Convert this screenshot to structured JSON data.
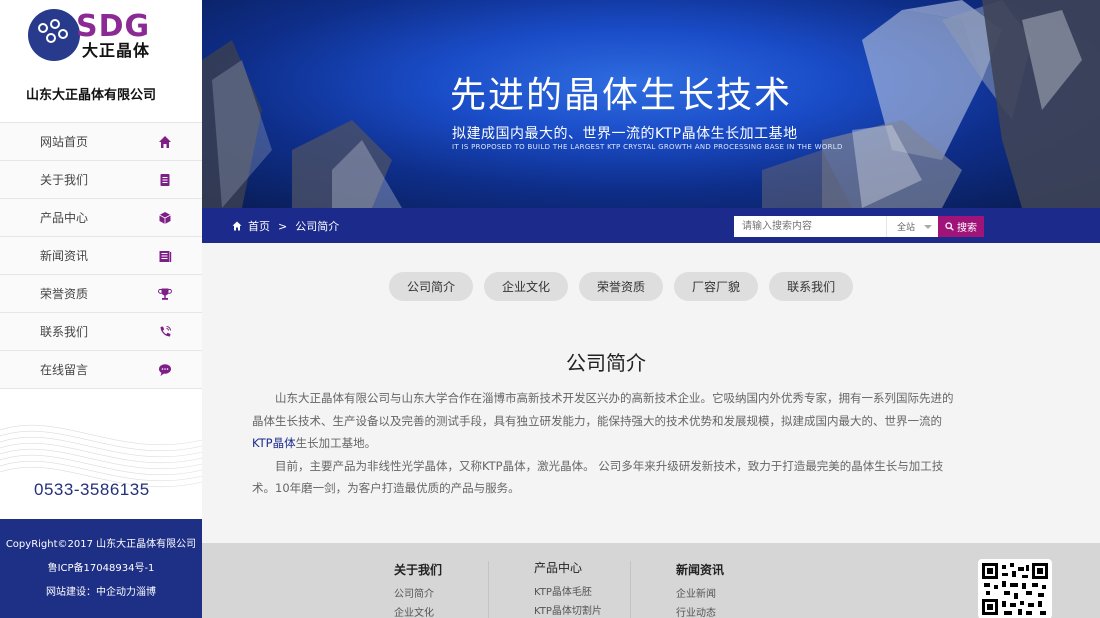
{
  "sidebar": {
    "logo_text": "SDG",
    "logo_cn": "大正晶体",
    "company_name": "山东大正晶体有限公司",
    "nav": [
      {
        "label": "网站首页",
        "icon": "home-icon"
      },
      {
        "label": "关于我们",
        "icon": "document-icon"
      },
      {
        "label": "产品中心",
        "icon": "cube-icon"
      },
      {
        "label": "新闻资讯",
        "icon": "news-icon"
      },
      {
        "label": "荣誉资质",
        "icon": "trophy-icon"
      },
      {
        "label": "联系我们",
        "icon": "phone-icon"
      },
      {
        "label": "在线留言",
        "icon": "chat-icon"
      }
    ],
    "phone": "0533-3586135",
    "footer": {
      "copyright": "CopyRight©2017 山东大正晶体有限公司",
      "icp": "鲁ICP备17048934号-1",
      "built_by": "网站建设：中企动力淄博"
    }
  },
  "banner": {
    "title": "先进的晶体生长技术",
    "subtitle": "拟建成国内最大的、世界一流的KTP晶体生长加工基地",
    "subtitle_en": "IT IS PROPOSED TO BUILD THE LARGEST KTP CRYSTAL GROWTH AND PROCESSING BASE IN THE WORLD"
  },
  "breadcrumb": {
    "home": "首页",
    "separator": ">",
    "current": "公司简介"
  },
  "search": {
    "placeholder": "请输入搜索内容",
    "scope": "全站",
    "button": "搜索"
  },
  "tabs": [
    "公司简介",
    "企业文化",
    "荣誉资质",
    "厂容厂貌",
    "联系我们"
  ],
  "content": {
    "title": "公司简介",
    "p1_a": "山东大正晶体有限公司与山东大学合作在淄博市高新技术开发区兴办的高新技术企业。它吸纳国内外优秀专家，拥有一系列国际先进的晶体生长技术、生产设备以及完善的测试手段，具有独立研发能力，能保持强大的技术优势和发展规模，拟建成国内最大的、世界一流的",
    "p1_link": "KTP晶体",
    "p1_b": "生长加工基地。",
    "p2": "目前，主要产品为非线性光学晶体，又称KTP晶体，激光晶体。 公司多年来升级研发新技术，致力于打造最完美的晶体生长与加工技术。10年磨一剑，为客户打造最优质的产品与服务。"
  },
  "footer": {
    "columns": [
      {
        "heading": "关于我们",
        "items": [
          "公司简介",
          "企业文化"
        ]
      },
      {
        "heading": "产品中心",
        "items": [
          "KTP晶体毛胚",
          "KTP晶体切割片"
        ]
      },
      {
        "heading": "新闻资讯",
        "items": [
          "企业新闻",
          "行业动态"
        ]
      }
    ]
  },
  "colors": {
    "navy": "#1c2a8c",
    "accent": "#a0147a",
    "logo_purple": "#8b2a94"
  }
}
